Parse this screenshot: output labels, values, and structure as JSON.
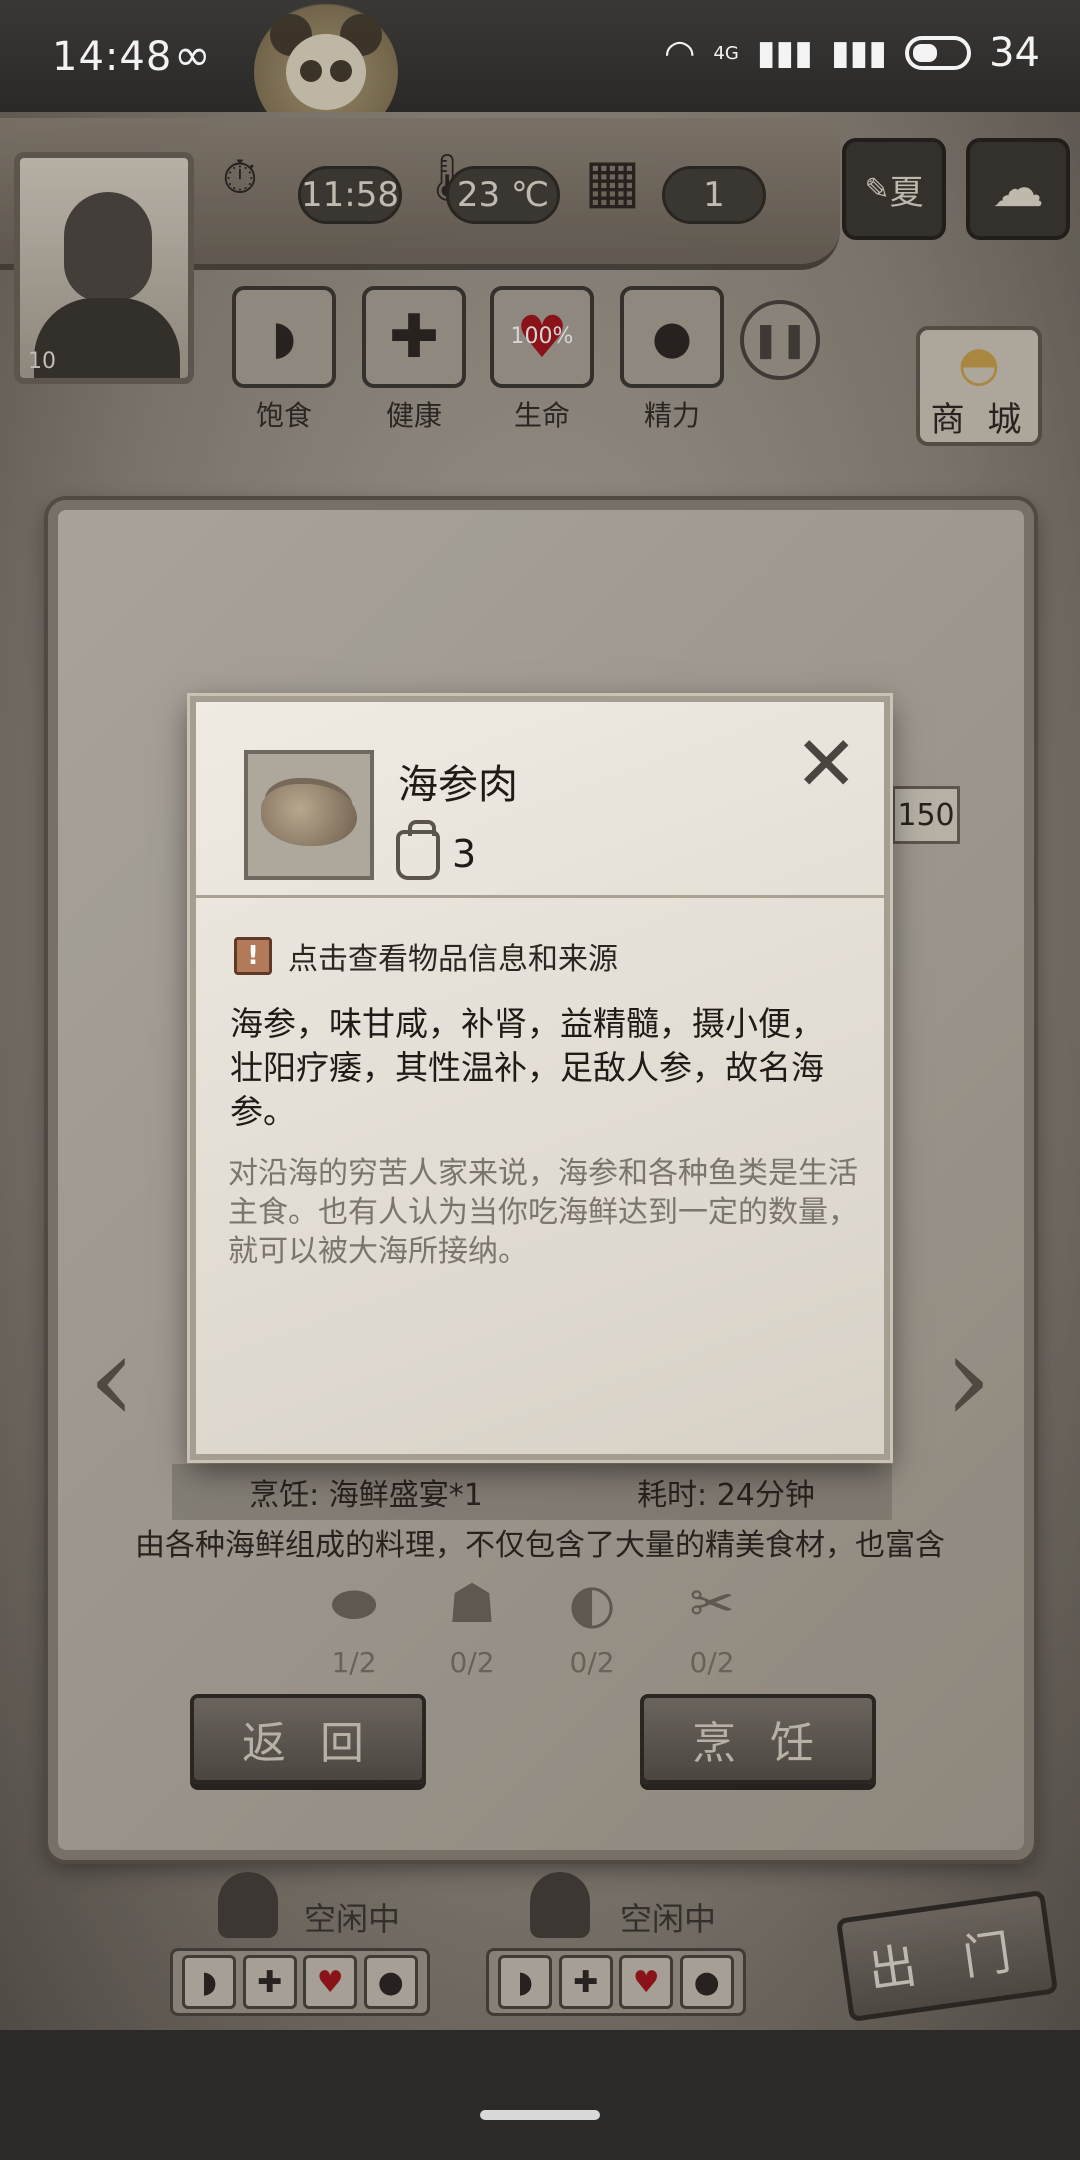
{
  "status_bar": {
    "time": "14:48",
    "loop_symbol": "∞",
    "network": "4G",
    "battery": "34"
  },
  "hud": {
    "character_level": "10",
    "clock": "11:58",
    "temperature": "23 ℃",
    "day": "1",
    "season": "夏",
    "vitals": [
      {
        "label": "饱食",
        "icon": "stomach-icon"
      },
      {
        "label": "健康",
        "icon": "cross-icon"
      },
      {
        "label": "生命",
        "icon": "heart-icon",
        "value": "100%"
      },
      {
        "label": "精力",
        "icon": "person-icon"
      }
    ],
    "shop_label": "商 城"
  },
  "panel": {
    "side_number": "150",
    "recipe_name": "烹饪: 海鲜盛宴*1",
    "recipe_time": "耗时: 24分钟",
    "recipe_desc": "由各种海鲜组成的料理，不仅包含了大量的精美食材，也富含",
    "ingredients": [
      {
        "icon": "fish-fillet-icon",
        "count": "1/2"
      },
      {
        "icon": "sea-cucumber-icon",
        "count": "0/2"
      },
      {
        "icon": "shrimp-icon",
        "count": "0/2"
      },
      {
        "icon": "crab-claw-icon",
        "count": "0/2"
      }
    ],
    "back_label": "返 回",
    "cook_label": "烹 饪"
  },
  "companions": [
    {
      "status": "空闲中"
    },
    {
      "status": "空闲中"
    }
  ],
  "go_out_label": "出 门",
  "popup": {
    "item_name": "海参肉",
    "item_count": "3",
    "info_hint": "点击查看物品信息和来源",
    "description": "海参，味甘咸，补肾，益精髓，摄小便，壮阳疗痿，其性温补，足敌人参，故名海参。",
    "lore": "对沿海的穷苦人家来说，海参和各种鱼类是生活主食。也有人认为当你吃海鲜达到一定的数量，就可以被大海所接纳。"
  }
}
